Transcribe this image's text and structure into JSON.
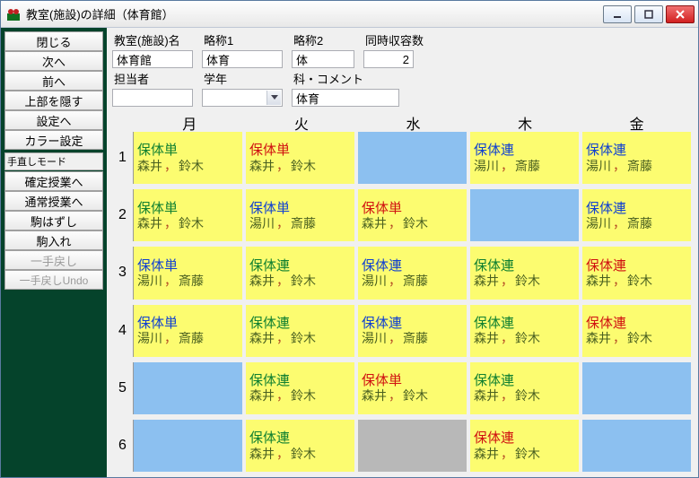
{
  "window": {
    "title": "教室(施設)の詳細（体育館）"
  },
  "winbtn": {
    "min": "minimize",
    "max": "maximize",
    "close": "close"
  },
  "sidebar": {
    "items": [
      {
        "id": "close",
        "label": "閉じる"
      },
      {
        "id": "next",
        "label": "次へ"
      },
      {
        "id": "prev",
        "label": "前へ"
      },
      {
        "id": "hidetop",
        "label": "上部を隠す"
      },
      {
        "id": "gosettings",
        "label": "設定へ"
      },
      {
        "id": "color",
        "label": "カラー設定"
      }
    ],
    "section_label": "手直しモード",
    "items2": [
      {
        "id": "fixed",
        "label": "確定授業へ"
      },
      {
        "id": "normal",
        "label": "通常授業へ"
      },
      {
        "id": "remove",
        "label": "駒はずし"
      },
      {
        "id": "insert",
        "label": "駒入れ"
      },
      {
        "id": "undo1",
        "label": "一手戻し",
        "disabled": true
      },
      {
        "id": "undo2",
        "label": "一手戻しUndo",
        "disabled": true
      }
    ]
  },
  "fields": {
    "room": {
      "label": "教室(施設)名",
      "value": "体育館"
    },
    "abbr1": {
      "label": "略称1",
      "value": "体育"
    },
    "abbr2": {
      "label": "略称2",
      "value": "体"
    },
    "capacity": {
      "label": "同時収容数",
      "value": "2"
    },
    "person": {
      "label": "担当者",
      "value": ""
    },
    "grade": {
      "label": "学年",
      "value": ""
    },
    "subject": {
      "label": "科・コメント",
      "value": "体育"
    }
  },
  "days": [
    "月",
    "火",
    "水",
    "木",
    "金"
  ],
  "periods": [
    "1",
    "2",
    "3",
    "4",
    "5",
    "6"
  ],
  "grid": [
    [
      {
        "bg": "yellow",
        "t": "保体単",
        "c": "cG",
        "p": [
          "森井",
          "鈴木"
        ]
      },
      {
        "bg": "yellow",
        "t": "保体単",
        "c": "cR",
        "p": [
          "森井",
          "鈴木"
        ]
      },
      {
        "bg": "blue"
      },
      {
        "bg": "yellow",
        "t": "保体連",
        "c": "cB",
        "p": [
          "湯川",
          "斎藤"
        ]
      },
      {
        "bg": "yellow",
        "t": "保体連",
        "c": "cB",
        "p": [
          "湯川",
          "斎藤"
        ]
      }
    ],
    [
      {
        "bg": "yellow",
        "t": "保体単",
        "c": "cG",
        "p": [
          "森井",
          "鈴木"
        ]
      },
      {
        "bg": "yellow",
        "t": "保体単",
        "c": "cB",
        "p": [
          "湯川",
          "斎藤"
        ]
      },
      {
        "bg": "yellow",
        "t": "保体単",
        "c": "cR",
        "p": [
          "森井",
          "鈴木"
        ]
      },
      {
        "bg": "blue"
      },
      {
        "bg": "yellow",
        "t": "保体連",
        "c": "cB",
        "p": [
          "湯川",
          "斎藤"
        ]
      }
    ],
    [
      {
        "bg": "yellow",
        "t": "保体単",
        "c": "cB",
        "p": [
          "湯川",
          "斎藤"
        ]
      },
      {
        "bg": "yellow",
        "t": "保体連",
        "c": "cG",
        "p": [
          "森井",
          "鈴木"
        ]
      },
      {
        "bg": "yellow",
        "t": "保体連",
        "c": "cB",
        "p": [
          "湯川",
          "斎藤"
        ]
      },
      {
        "bg": "yellow",
        "t": "保体連",
        "c": "cG",
        "p": [
          "森井",
          "鈴木"
        ]
      },
      {
        "bg": "yellow",
        "t": "保体連",
        "c": "cR",
        "p": [
          "森井",
          "鈴木"
        ]
      }
    ],
    [
      {
        "bg": "yellow",
        "t": "保体単",
        "c": "cB",
        "p": [
          "湯川",
          "斎藤"
        ]
      },
      {
        "bg": "yellow",
        "t": "保体連",
        "c": "cG",
        "p": [
          "森井",
          "鈴木"
        ]
      },
      {
        "bg": "yellow",
        "t": "保体連",
        "c": "cB",
        "p": [
          "湯川",
          "斎藤"
        ]
      },
      {
        "bg": "yellow",
        "t": "保体連",
        "c": "cG",
        "p": [
          "森井",
          "鈴木"
        ]
      },
      {
        "bg": "yellow",
        "t": "保体連",
        "c": "cR",
        "p": [
          "森井",
          "鈴木"
        ]
      }
    ],
    [
      {
        "bg": "blue"
      },
      {
        "bg": "yellow",
        "t": "保体連",
        "c": "cG",
        "p": [
          "森井",
          "鈴木"
        ]
      },
      {
        "bg": "yellow",
        "t": "保体単",
        "c": "cR",
        "p": [
          "森井",
          "鈴木"
        ]
      },
      {
        "bg": "yellow",
        "t": "保体連",
        "c": "cG",
        "p": [
          "森井",
          "鈴木"
        ]
      },
      {
        "bg": "blue"
      }
    ],
    [
      {
        "bg": "blue"
      },
      {
        "bg": "yellow",
        "t": "保体連",
        "c": "cG",
        "p": [
          "森井",
          "鈴木"
        ]
      },
      {
        "bg": "gray"
      },
      {
        "bg": "yellow",
        "t": "保体連",
        "c": "cR",
        "p": [
          "森井",
          "鈴木"
        ]
      },
      {
        "bg": "blue"
      }
    ]
  ]
}
